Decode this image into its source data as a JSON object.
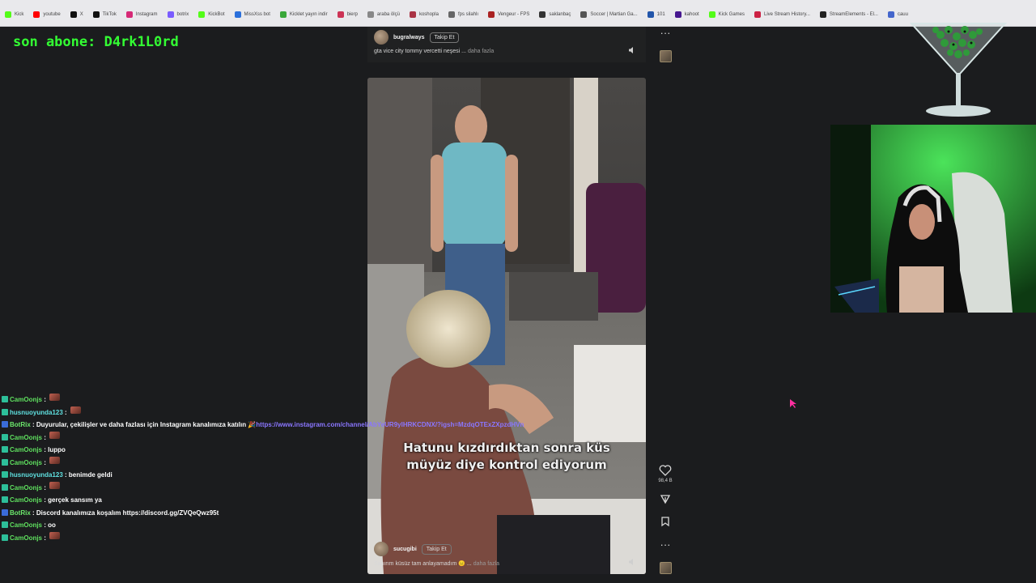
{
  "bookmarks": [
    {
      "label": "Kick",
      "color": "#53fc18"
    },
    {
      "label": "youtube",
      "color": "#ff0000"
    },
    {
      "label": "X",
      "color": "#111111"
    },
    {
      "label": "TikTok",
      "color": "#111111"
    },
    {
      "label": "Instagram",
      "color": "#d62976"
    },
    {
      "label": "botrix",
      "color": "#7a5cff"
    },
    {
      "label": "KickBot",
      "color": "#53fc18"
    },
    {
      "label": "MissXss bot",
      "color": "#2a6fdb"
    },
    {
      "label": "Kicklet yayın indir",
      "color": "#3aa83a"
    },
    {
      "label": "bierp",
      "color": "#cc3355"
    },
    {
      "label": "araba ölçü",
      "color": "#888888"
    },
    {
      "label": "koshopla",
      "color": "#aa3344"
    },
    {
      "label": "fps silahlı",
      "color": "#666666"
    },
    {
      "label": "Vengeur - FPS",
      "color": "#aa2222"
    },
    {
      "label": "saklanbaç",
      "color": "#333333"
    },
    {
      "label": "Soccer | Martian Ga...",
      "color": "#555555"
    },
    {
      "label": "101",
      "color": "#2255aa"
    },
    {
      "label": "kahoot",
      "color": "#46178f"
    },
    {
      "label": "Kick Games",
      "color": "#53fc18"
    },
    {
      "label": "Live Stream History...",
      "color": "#cc2244"
    },
    {
      "label": "StreamElements - El...",
      "color": "#222222"
    },
    {
      "label": "cauu",
      "color": "#4466cc"
    }
  ],
  "overlay": {
    "last_sub": "son abone: D4rk1L0rd"
  },
  "top_post": {
    "username": "bugralways",
    "follow_label": "Takip Et",
    "caption": "gta vice city tommy vercetti neşesi ...",
    "more": "daha fazla"
  },
  "reel": {
    "subtitle_line1": "Hatunu kızdırdıktan sonra küs",
    "subtitle_line2": "müyüz diye kontrol ediyorum",
    "username": "sucugibi",
    "follow_label": "Takip Et",
    "caption": "Sanırım küsüz tam anlayamadım 😑 ...",
    "more": "daha fazla",
    "like_count": "98,4 B"
  },
  "icons": {
    "more_top": "more-horizontal-icon",
    "like": "heart-icon",
    "share": "send-icon",
    "save": "bookmark-icon",
    "more": "more-horizontal-icon",
    "mute": "volume-icon"
  },
  "chat": [
    {
      "user": "CamOonjs",
      "text": "",
      "type": "user",
      "color": "green",
      "emote": true
    },
    {
      "user": "husnuoyunda123",
      "text": "",
      "type": "user",
      "color": "cyan",
      "emote": true
    },
    {
      "user": "BotRix",
      "text": "Duyurular, çekilişler ve daha fazlası için Instagram kanalımıza katılın 🎉",
      "link": "https://www.instagram.com/channel/AbYeUR9ylHRKCDNX/?igsh=MzdqOTExZXpzdHVn",
      "type": "bot"
    },
    {
      "user": "CamOonjs",
      "text": "",
      "type": "user",
      "color": "green",
      "emote": true
    },
    {
      "user": "CamOonjs",
      "text": "luppo",
      "type": "user",
      "color": "green"
    },
    {
      "user": "CamOonjs",
      "text": "",
      "type": "user",
      "color": "green",
      "emote": true
    },
    {
      "user": "husnuoyunda123",
      "text": "benimde geldi",
      "type": "user",
      "color": "cyan"
    },
    {
      "user": "CamOonjs",
      "text": "",
      "type": "user",
      "color": "green",
      "emote": true
    },
    {
      "user": "CamOonjs",
      "text": "gerçek sansım ya",
      "type": "user",
      "color": "green"
    },
    {
      "user": "BotRix",
      "text": "Discord kanalımıza koşalım https://discord.gg/ZVQeQwz95t",
      "type": "bot"
    },
    {
      "user": "CamOonjs",
      "text": "oo",
      "type": "user",
      "color": "green"
    },
    {
      "user": "CamOonjs",
      "text": "",
      "type": "user",
      "color": "green",
      "emote": true
    }
  ],
  "colors": {
    "subs_text": "#33ff33",
    "bot_link": "#8a76ff",
    "cursor": "#ff2fa0"
  }
}
